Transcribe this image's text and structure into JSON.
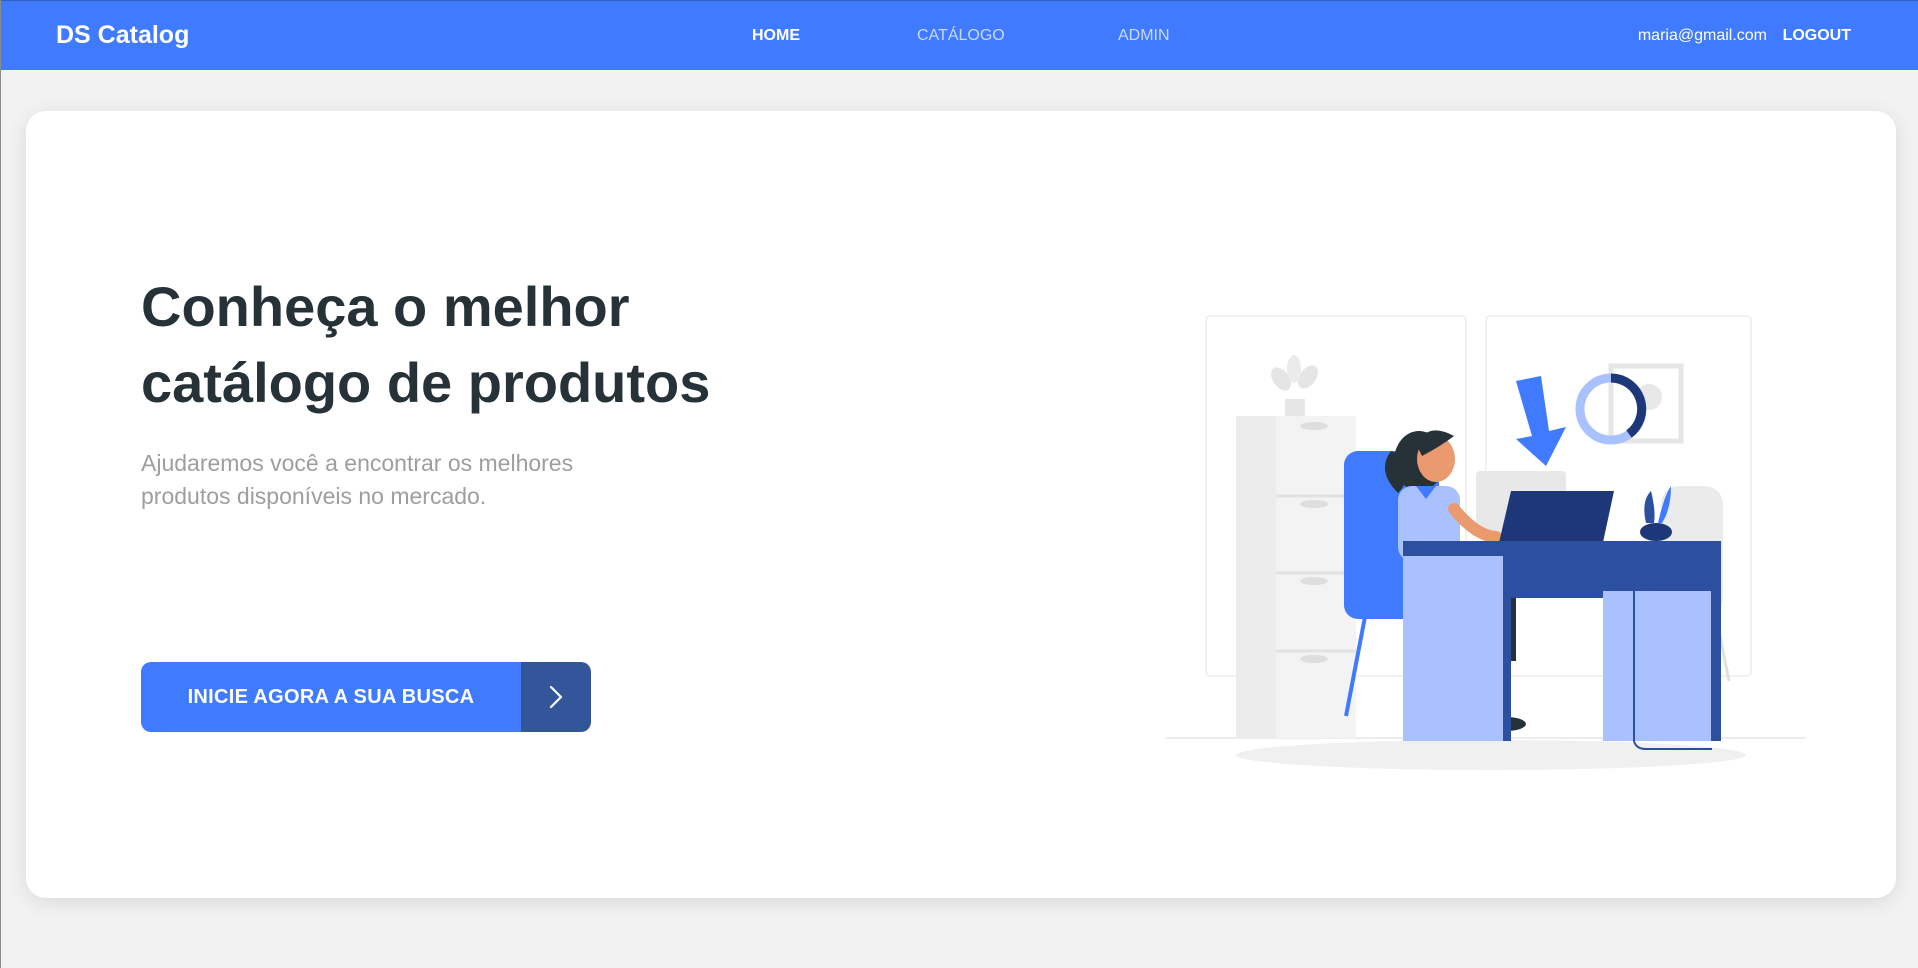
{
  "navbar": {
    "brand": "DS Catalog",
    "links": [
      {
        "label": "HOME",
        "active": true
      },
      {
        "label": "CATÁLOGO",
        "active": false
      },
      {
        "label": "ADMIN",
        "active": false
      }
    ],
    "user_email": "maria@gmail.com",
    "logout_label": "LOGOUT"
  },
  "hero": {
    "title": "Conheça o melhor catálogo de produtos",
    "subtitle": "Ajudaremos você a encontrar os melhores produtos disponíveis no mercado.",
    "cta_label": "INICIE AGORA A SUA BUSCA",
    "cta_icon": "chevron-right-icon",
    "illustration": "woman-working-at-laptop-illustration"
  },
  "colors": {
    "primary": "#407bff",
    "primary_dark": "#33569b",
    "title_text": "#263238",
    "subtitle_text": "#9e9e9e",
    "page_background": "#f2f2f2"
  }
}
